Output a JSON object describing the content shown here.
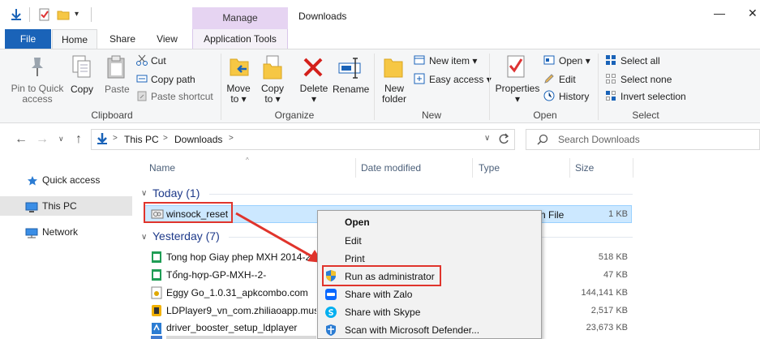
{
  "window": {
    "title": "Downloads",
    "contextual_tab_group": "Manage",
    "controls": {
      "minimize": "—",
      "close": "✕"
    }
  },
  "tabs": [
    "File",
    "Home",
    "Share",
    "View",
    "Application Tools"
  ],
  "ribbon": {
    "clipboard": {
      "group": "Clipboard",
      "pin": "Pin to Quick access",
      "pin_line1": "Pin to Quick",
      "pin_line2": "access",
      "copy": "Copy",
      "paste": "Paste",
      "cut": "Cut",
      "copy_path": "Copy path",
      "paste_shortcut": "Paste shortcut"
    },
    "organize": {
      "group": "Organize",
      "move_to": "Move",
      "move_to2": "to",
      "copy_to": "Copy",
      "copy_to2": "to",
      "delete": "Delete",
      "rename": "Rename"
    },
    "new": {
      "group": "New",
      "new_folder": "New",
      "new_folder2": "folder",
      "new_item": "New item",
      "easy_access": "Easy access"
    },
    "open": {
      "group": "Open",
      "properties": "Properties",
      "open": "Open",
      "edit": "Edit",
      "history": "History"
    },
    "select": {
      "group": "Select",
      "select_all": "Select all",
      "select_none": "Select none",
      "invert": "Invert selection"
    }
  },
  "address": {
    "crumbs": [
      "This PC",
      "Downloads"
    ],
    "separator": ">",
    "search_placeholder": "Search Downloads"
  },
  "sidebar": {
    "items": [
      {
        "label": "Quick access",
        "icon": "star-icon"
      },
      {
        "label": "This PC",
        "icon": "monitor-icon",
        "selected": true
      },
      {
        "label": "Network",
        "icon": "network-icon"
      }
    ]
  },
  "columns": [
    "Name",
    "Date modified",
    "Type",
    "Size"
  ],
  "groups": [
    {
      "label": "Today (1)"
    },
    {
      "label": "Yesterday (7)"
    }
  ],
  "files": {
    "today": [
      {
        "name": "winsock_reset",
        "type_partial": "n File",
        "size": "1 KB",
        "icon": "batch-file-icon"
      }
    ],
    "yesterday": [
      {
        "name": "Tong hop Giay phep MXH 2014-2",
        "size": "518 KB",
        "icon": "sheet-icon"
      },
      {
        "name": "Tổng-hợp-GP-MXH--2-",
        "size": "47 KB",
        "icon": "sheet-icon"
      },
      {
        "name": "Eggy Go_1.0.31_apkcombo.com",
        "size": "144,141 KB",
        "icon": "apk-icon"
      },
      {
        "name": "LDPlayer9_vn_com.zhiliaoapp.musi",
        "size": "2,517 KB",
        "icon": "app-icon"
      },
      {
        "name": "driver_booster_setup_ldplayer",
        "size": "23,673 KB",
        "icon": "setup-icon"
      },
      {
        "name": "",
        "size": "",
        "icon": "partial-icon"
      }
    ]
  },
  "context_menu": {
    "items": [
      {
        "label": "Open",
        "bold": true
      },
      {
        "label": "Edit"
      },
      {
        "label": "Print"
      },
      {
        "label": "Run as administrator",
        "icon": "shield-icon",
        "highlighted": true
      },
      {
        "label": "Share with Zalo",
        "icon": "zalo-icon"
      },
      {
        "label": "Share with Skype",
        "icon": "skype-icon"
      },
      {
        "label": "Scan with Microsoft Defender...",
        "icon": "defender-icon"
      }
    ]
  },
  "colors": {
    "file_tab": "#1a63b8",
    "manage": "#e6d4f2",
    "selection": "#cce8ff",
    "annotation": "#e0342c",
    "group_header": "#1e3a8a"
  }
}
